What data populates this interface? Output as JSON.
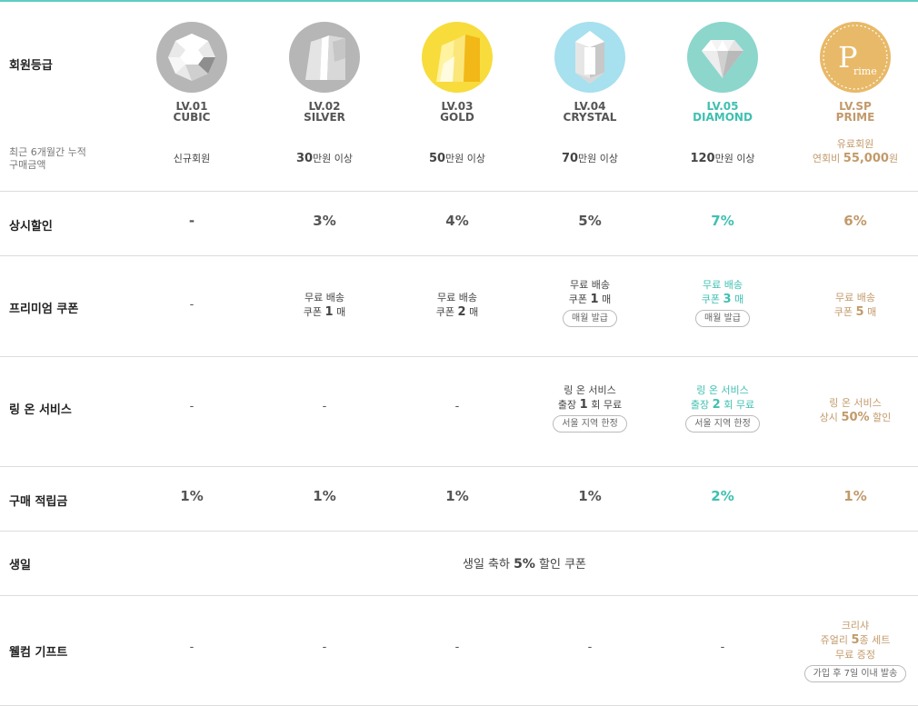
{
  "labels": {
    "grade": "회원등급",
    "purchase_line1": "최근 6개월간 누적",
    "purchase_line2": "구매금액",
    "discount": "상시할인",
    "coupon": "프리미엄 쿠폰",
    "ring_service": "링 온 서비스",
    "points": "구매 적립금",
    "birthday": "생일",
    "welcome": "웰컴 기프트"
  },
  "levels": [
    {
      "lv": "LV.01",
      "name": "CUBIC",
      "badge": "cubic-badge-icon",
      "color": "#b6b6b6"
    },
    {
      "lv": "LV.02",
      "name": "SILVER",
      "badge": "silver-badge-icon",
      "color": "#b6b6b6"
    },
    {
      "lv": "LV.03",
      "name": "GOLD",
      "badge": "gold-badge-icon",
      "color": "#f7dc3c"
    },
    {
      "lv": "LV.04",
      "name": "CRYSTAL",
      "badge": "crystal-badge-icon",
      "color": "#a7e0ee"
    },
    {
      "lv": "LV.05",
      "name": "DIAMOND",
      "badge": "diamond-badge-icon",
      "color": "#8cd6cc"
    },
    {
      "lv": "LV.SP",
      "name": "PRIME",
      "badge": "prime-badge-icon",
      "color": "#e8b968",
      "badge_letter": "P",
      "badge_text": "rime"
    }
  ],
  "purchase": {
    "cubic": "신규회원",
    "silver_num": "30",
    "silver_unit": "만원 이상",
    "gold_num": "50",
    "gold_unit": "만원 이상",
    "crystal_num": "70",
    "crystal_unit": "만원 이상",
    "diamond_num": "120",
    "diamond_unit": "만원 이상",
    "prime_line1": "유료회원",
    "prime_line2_prefix": "연회비 ",
    "prime_line2_num": "55,000",
    "prime_line2_unit": "원"
  },
  "discount": [
    "-",
    "3%",
    "4%",
    "5%",
    "7%",
    "6%"
  ],
  "coupon": {
    "cubic": "-",
    "silver_line1": "무료 배송",
    "silver_line2_a": "쿠폰 ",
    "silver_line2_num": "1",
    "silver_line2_b": " 매",
    "gold_line1": "무료 배송",
    "gold_line2_a": "쿠폰 ",
    "gold_line2_num": "2",
    "gold_line2_b": " 매",
    "crystal_line1": "무료 배송",
    "crystal_line2_a": "쿠폰 ",
    "crystal_line2_num": "1",
    "crystal_line2_b": " 매",
    "crystal_pill": "매월 발급",
    "diamond_line1": "무료 배송",
    "diamond_line2_a": "쿠폰 ",
    "diamond_line2_num": "3",
    "diamond_line2_b": " 매",
    "diamond_pill": "매월 발급",
    "prime_line1": "무료 배송",
    "prime_line2_a": "쿠폰 ",
    "prime_line2_num": "5",
    "prime_line2_b": " 매"
  },
  "ring": {
    "cubic": "-",
    "silver": "-",
    "gold": "-",
    "crystal_line1": "링 온 서비스",
    "crystal_line2_a": "출장 ",
    "crystal_line2_num": "1",
    "crystal_line2_b": " 회 무료",
    "crystal_pill": "서울 지역 한정",
    "diamond_line1": "링 온 서비스",
    "diamond_line2_a": "출장 ",
    "diamond_line2_num": "2",
    "diamond_line2_b": " 회 무료",
    "diamond_pill": "서울 지역 한정",
    "prime_line1": "링 온 서비스",
    "prime_line2_a": "상시 ",
    "prime_line2_num": "50%",
    "prime_line2_b": " 할인"
  },
  "points": [
    "1%",
    "1%",
    "1%",
    "1%",
    "2%",
    "1%"
  ],
  "birthday": {
    "prefix": "생일 축하 ",
    "num": "5%",
    "suffix": " 할인 쿠폰"
  },
  "welcome": {
    "dashes": [
      "-",
      "-",
      "-",
      "-",
      "-"
    ],
    "prime_line1": "크리샤",
    "prime_line2_a": "쥬얼리 ",
    "prime_line2_num": "5",
    "prime_line2_b": "종 세트",
    "prime_line3": "무료 증정",
    "prime_pill": "가입 후 7일 이내 발송"
  },
  "colors": {
    "accent_teal": "#3fc0b1",
    "accent_gold": "#c29a6a",
    "top_line": "#5fcdbf"
  }
}
